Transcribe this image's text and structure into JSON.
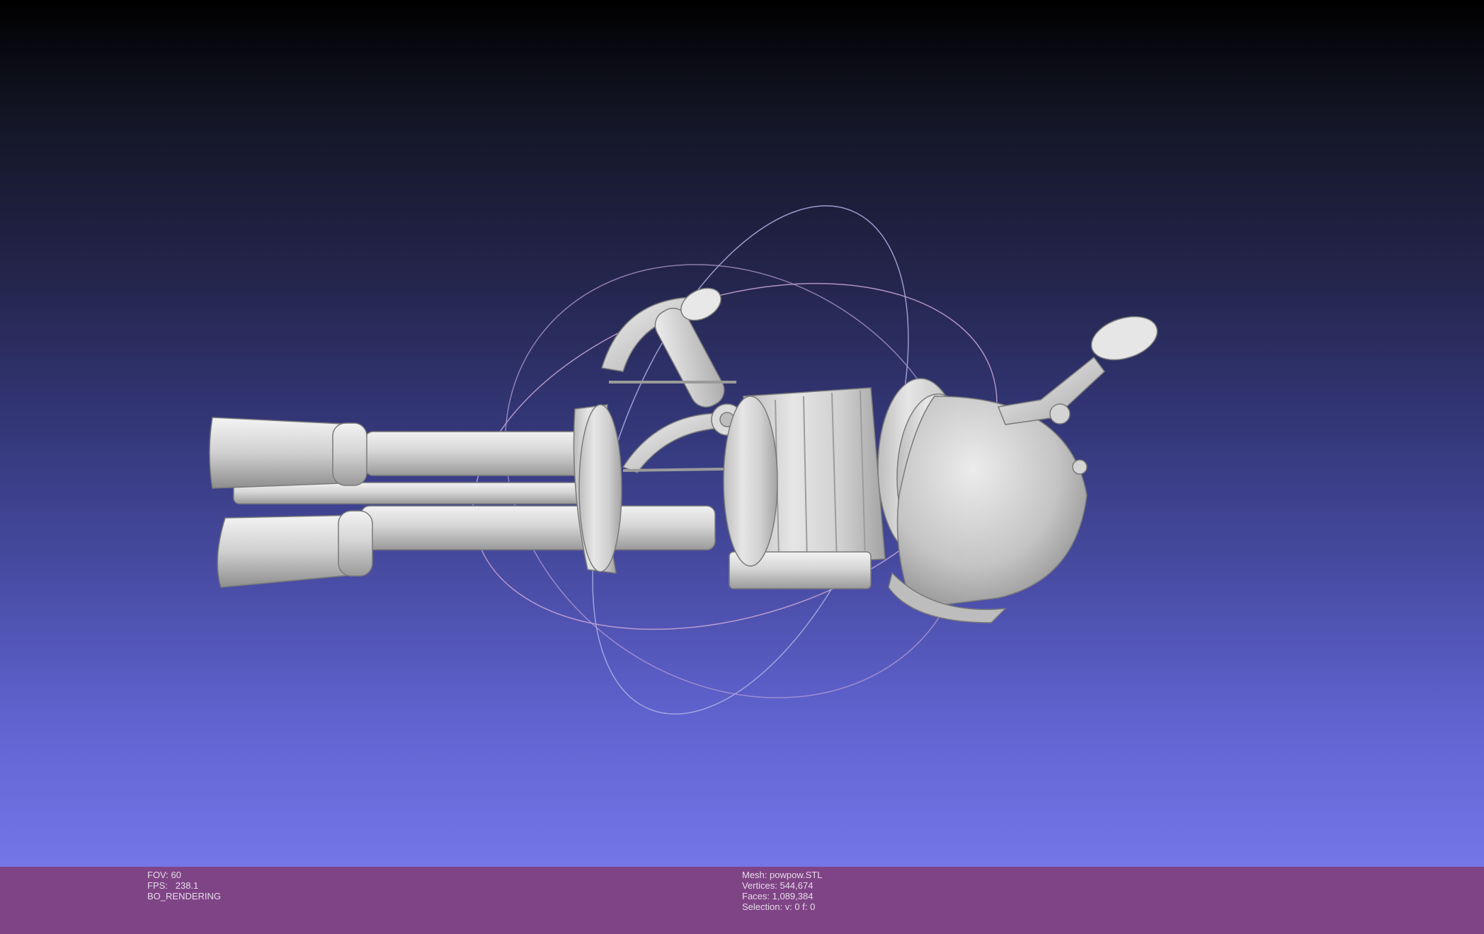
{
  "viewer": {
    "background_top": "#000000",
    "background_bottom": "#7476e8",
    "statusbar_color": "#7f4486",
    "mesh_color": "#cfcfcf",
    "trackball_colors": [
      "#c9a6d6",
      "#9fa0d8",
      "#b7b9e6"
    ]
  },
  "status": {
    "left": {
      "fov": "FOV: 60",
      "fps": "FPS:   238.1",
      "mode": "BO_RENDERING"
    },
    "right": {
      "mesh": "Mesh: powpow.STL",
      "vertices": "Vertices: 544,674",
      "faces": "Faces: 1,089,384",
      "selection": "Selection: v: 0 f: 0"
    }
  }
}
